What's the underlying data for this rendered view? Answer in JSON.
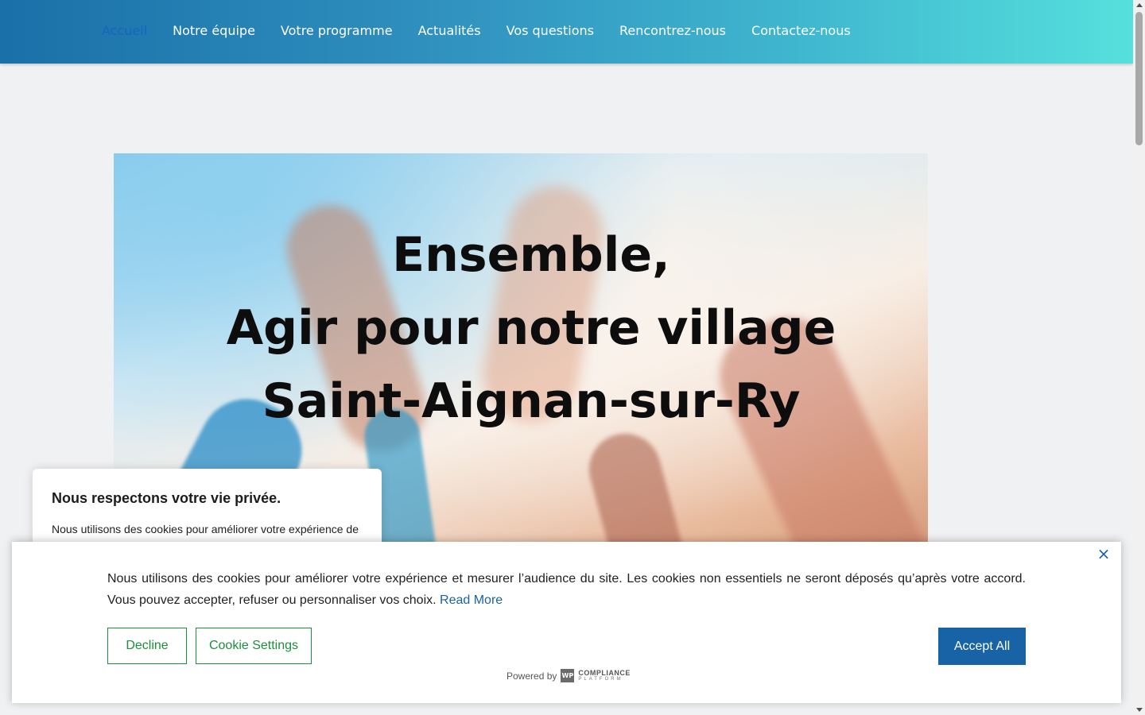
{
  "nav": {
    "items": [
      {
        "label": "Accueil",
        "active": true
      },
      {
        "label": "Notre équipe"
      },
      {
        "label": "Votre programme"
      },
      {
        "label": "Actualités"
      },
      {
        "label": "Vos questions"
      },
      {
        "label": "Rencontrez-nous"
      },
      {
        "label": "Contactez-nous"
      }
    ]
  },
  "hero": {
    "title_lines": [
      "Ensemble,",
      "Agir pour notre village",
      "Saint-Aignan-sur-Ry"
    ]
  },
  "privacy_card": {
    "title": "Nous respectons votre vie privée.",
    "text": "Nous utilisons des cookies pour améliorer votre expérience de"
  },
  "cookie_banner": {
    "text": "Nous utilisons des cookies pour améliorer votre expérience et mesurer l’audience du site. Les cookies non essentiels ne seront déposés qu’après votre accord. Vous pouvez accepter, refuser ou personnaliser vos choix.",
    "read_more": "Read More",
    "decline_label": "Decline",
    "settings_label": "Cookie Settings",
    "accept_label": "Accept All",
    "close_icon": "×",
    "powered_by": "Powered by",
    "logo_mark": "WP",
    "logo_line1": "COMPLIANCE",
    "logo_line2": "PLATFORM"
  },
  "colors": {
    "accent": "#1863a6",
    "outline_green": "#1c8f3c",
    "active_nav": "#1565c0"
  }
}
